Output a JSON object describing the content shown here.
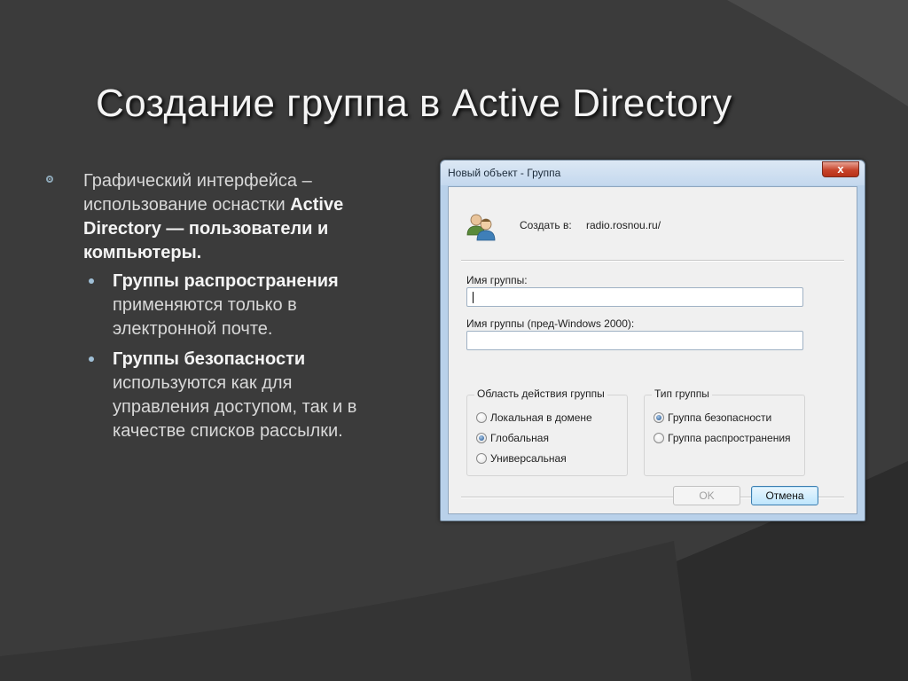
{
  "slide": {
    "title": "Создание группа в Active Directory",
    "bullet1": {
      "text_plain": "Графический интерфейса – использование оснастки ",
      "text_bold": "Active Directory — пользователи и компьютеры."
    },
    "sub_bullets": [
      {
        "bold": "Группы распространения",
        "text": "применяются только в электронной почте."
      },
      {
        "bold": "Группы безопасности",
        "text": "используются как для управления доступом, так и в качестве списков рассылки."
      }
    ]
  },
  "dialog": {
    "title": "Новый объект - Группа",
    "close_label": "x",
    "create_in_label": "Создать в:",
    "create_in_value": "radio.rosnou.ru/",
    "group_name_label": "Имя группы:",
    "group_name_value": "",
    "group_name_pre2000_label": "Имя группы (пред-Windows 2000):",
    "group_name_pre2000_value": "",
    "scope": {
      "legend": "Область действия группы",
      "options": [
        "Локальная в домене",
        "Глобальная",
        "Универсальная"
      ],
      "selected": "Глобальная"
    },
    "type": {
      "legend": "Тип группы",
      "options": [
        "Группа безопасности",
        "Группа распространения"
      ],
      "selected": "Группа безопасности"
    },
    "ok_label": "OK",
    "cancel_label": "Отмена"
  },
  "colors": {
    "background": "#3b3b3b",
    "dialog_frame": "#b9d1ea",
    "accent_button": "#3c7fb1"
  }
}
